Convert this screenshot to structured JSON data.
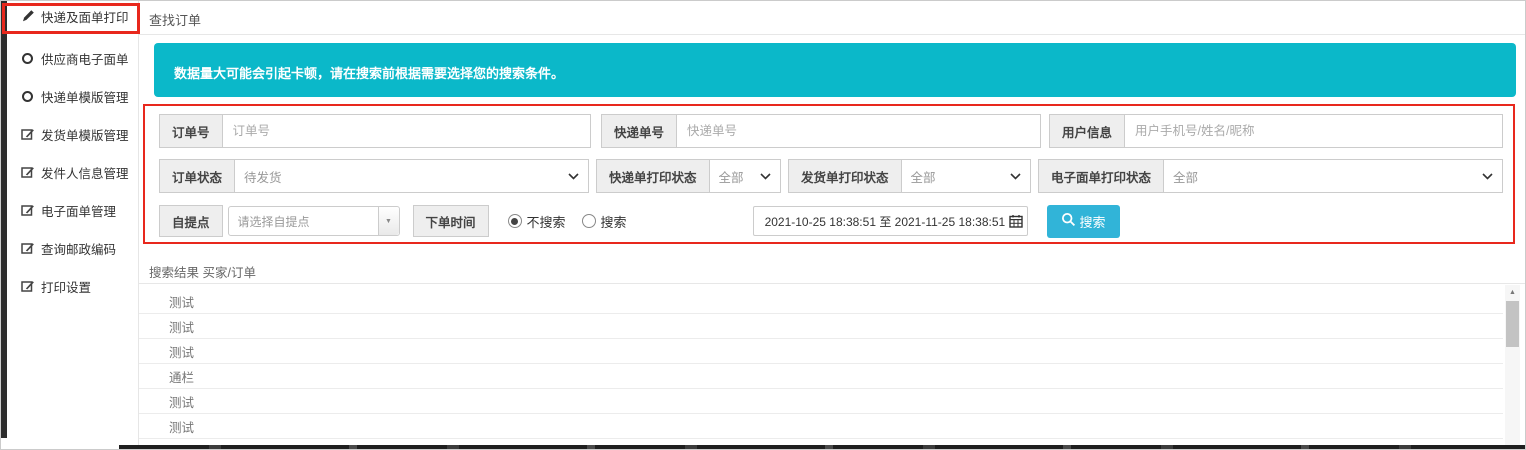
{
  "colors": {
    "alert_bg": "#0bb8c9",
    "search_button_bg": "#31b4d8",
    "annotation_red": "#e8281d"
  },
  "sidebar": {
    "items": [
      {
        "label": "快递及面单打印",
        "icon": "pencil-icon",
        "highlighted": true
      },
      {
        "label": "供应商电子面单",
        "icon": "circle-icon",
        "highlighted": false
      },
      {
        "label": "快递单模版管理",
        "icon": "circle-icon",
        "highlighted": false
      },
      {
        "label": "发货单模版管理",
        "icon": "edit-icon",
        "highlighted": false
      },
      {
        "label": "发件人信息管理",
        "icon": "edit-icon",
        "highlighted": false
      },
      {
        "label": "电子面单管理",
        "icon": "edit-icon",
        "highlighted": false
      },
      {
        "label": "查询邮政编码",
        "icon": "edit-icon",
        "highlighted": false
      },
      {
        "label": "打印设置",
        "icon": "edit-icon",
        "highlighted": false
      }
    ]
  },
  "header": {
    "title": "查找订单"
  },
  "alert": {
    "text": "数据量大可能会引起卡顿，请在搜索前根据需要选择您的搜索条件。"
  },
  "form": {
    "row1": {
      "order_no": {
        "label": "订单号",
        "placeholder": "订单号",
        "value": ""
      },
      "tracking_no": {
        "label": "快递单号",
        "placeholder": "快递单号",
        "value": ""
      },
      "user_info": {
        "label": "用户信息",
        "placeholder": "用户手机号/姓名/昵称",
        "value": ""
      }
    },
    "row2": {
      "order_status": {
        "label": "订单状态",
        "value": "待发货"
      },
      "express_print_status": {
        "label": "快递单打印状态",
        "value": "全部"
      },
      "shipping_print_status": {
        "label": "发货单打印状态",
        "value": "全部"
      },
      "eorder_print_status": {
        "label": "电子面单打印状态",
        "value": "全部"
      }
    },
    "row3": {
      "pickup_label": "自提点",
      "pickup_placeholder": "请选择自提点",
      "order_time_label": "下单时间",
      "radio_no_search": "不搜索",
      "radio_search": "搜索",
      "radio_selected": "不搜索",
      "date_range": "2021-10-25 18:38:51 至 2021-11-25 18:38:51",
      "search_button": "搜索"
    }
  },
  "results": {
    "title": "搜索结果 买家/订单",
    "rows": [
      "测试",
      "测试",
      "测试",
      "通栏",
      "测试",
      "测试"
    ]
  }
}
